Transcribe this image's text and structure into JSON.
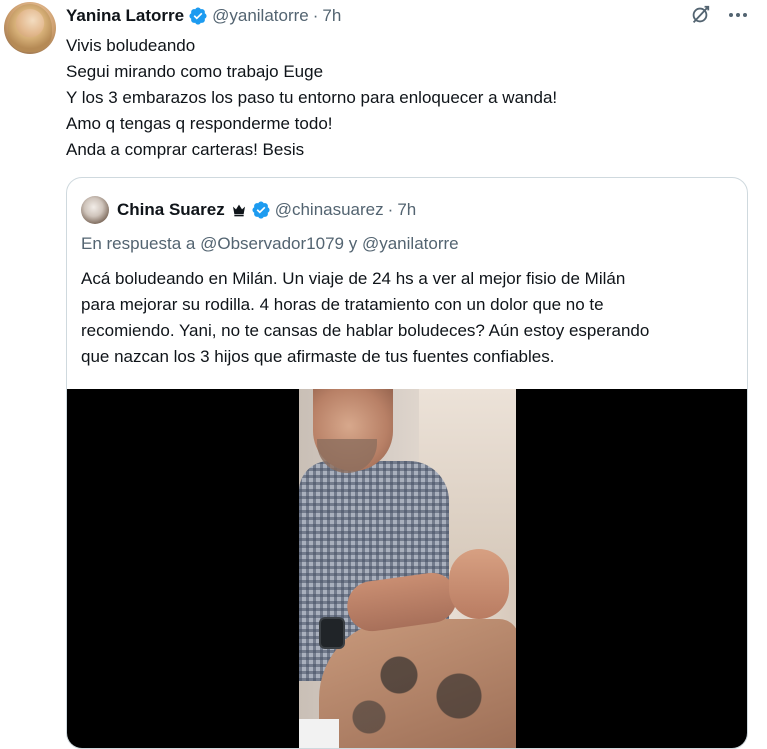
{
  "tweet": {
    "author_name": "Yanina Latorre",
    "handle": "@yanilatorre",
    "separator": "·",
    "time": "7h",
    "lines": [
      "Vivis boludeando",
      "Segui mirando como trabajo Euge",
      "Y los 3 embarazos los paso tu entorno para enloquecer a wanda!",
      "Amo q tengas q responderme todo!",
      "Anda a comprar carteras! Besis"
    ]
  },
  "quote": {
    "author_name": "China Suarez",
    "handle": "@chinasuarez",
    "separator": "·",
    "time": "7h",
    "reply_prefix": "En respuesta a",
    "reply_user1": "@Observador1079",
    "reply_and": "y",
    "reply_user2": "@yanilatorre",
    "lines": [
      "Acá boludeando en Milán. Un viaje de 24 hs a ver al mejor fisio de Milán",
      "para mejorar su rodilla. 4 horas de tratamiento con un dolor que no te",
      "recomiendo. Yani, no te cansas de hablar boludeces? Aún estoy esperando",
      "que nazcan los 3 hijos que afirmaste de tus fuentes confiables."
    ]
  },
  "icons": {
    "verified": "verified-badge-icon",
    "crown": "crown-icon",
    "grok": "grok-icon",
    "more": "more-icon"
  },
  "colors": {
    "verified": "#1d9bf0",
    "secondary_text": "#536471",
    "border": "#cfd9de"
  }
}
